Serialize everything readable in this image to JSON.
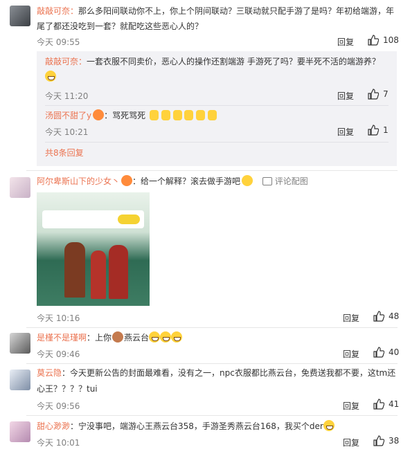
{
  "colors": {
    "accent": "#eb7350",
    "time": "#808080",
    "reply_bg": "#f2f2f5"
  },
  "labels": {
    "reply": "回复"
  },
  "comments": [
    {
      "user": "敲敲可奈：",
      "text": "那么多阳间联动你不上，你上个阴间联动？三联动就只配手游了是吗？年初给端游，年尾了都还没吃到一套？就配吃这些恶心人的？",
      "time": "今天 09:55",
      "likes": "108",
      "replies": [
        {
          "user": "敲敲可奈：",
          "text": "一套衣服不同卖价，恶心人的操作还割端游 手游死了吗？要半死不活的端游养？",
          "time": "今天 11:20",
          "likes": "7"
        },
        {
          "user": "汤圆不甜了y",
          "text": "：骂死骂死",
          "time": "今天 10:21",
          "likes": "1"
        }
      ],
      "more_replies": "共8条回复"
    },
    {
      "user": "阿尔卑斯山下的少女丶",
      "text": "：给一个解释？滚去做手游吧",
      "link": "评论配图",
      "time": "今天 10:16",
      "likes": "48"
    },
    {
      "user": "是槿不是瑾啊",
      "text": "：上你",
      "tail": "燕云台",
      "time": "今天 09:46",
      "likes": "40"
    },
    {
      "user": "莫云隐",
      "text": "：今天更新公告的封面最难看，没有之一，npc衣服都比燕云台，免费送我都不要，这tm还心王？？？？tui",
      "time": "今天 09:56",
      "likes": "41"
    },
    {
      "user": "甜心渺渺",
      "text": "：宁没事吧，端游心王燕云台358，手游圣秀燕云台168，我买个der",
      "time": "今天 10:01",
      "likes": "38"
    }
  ]
}
